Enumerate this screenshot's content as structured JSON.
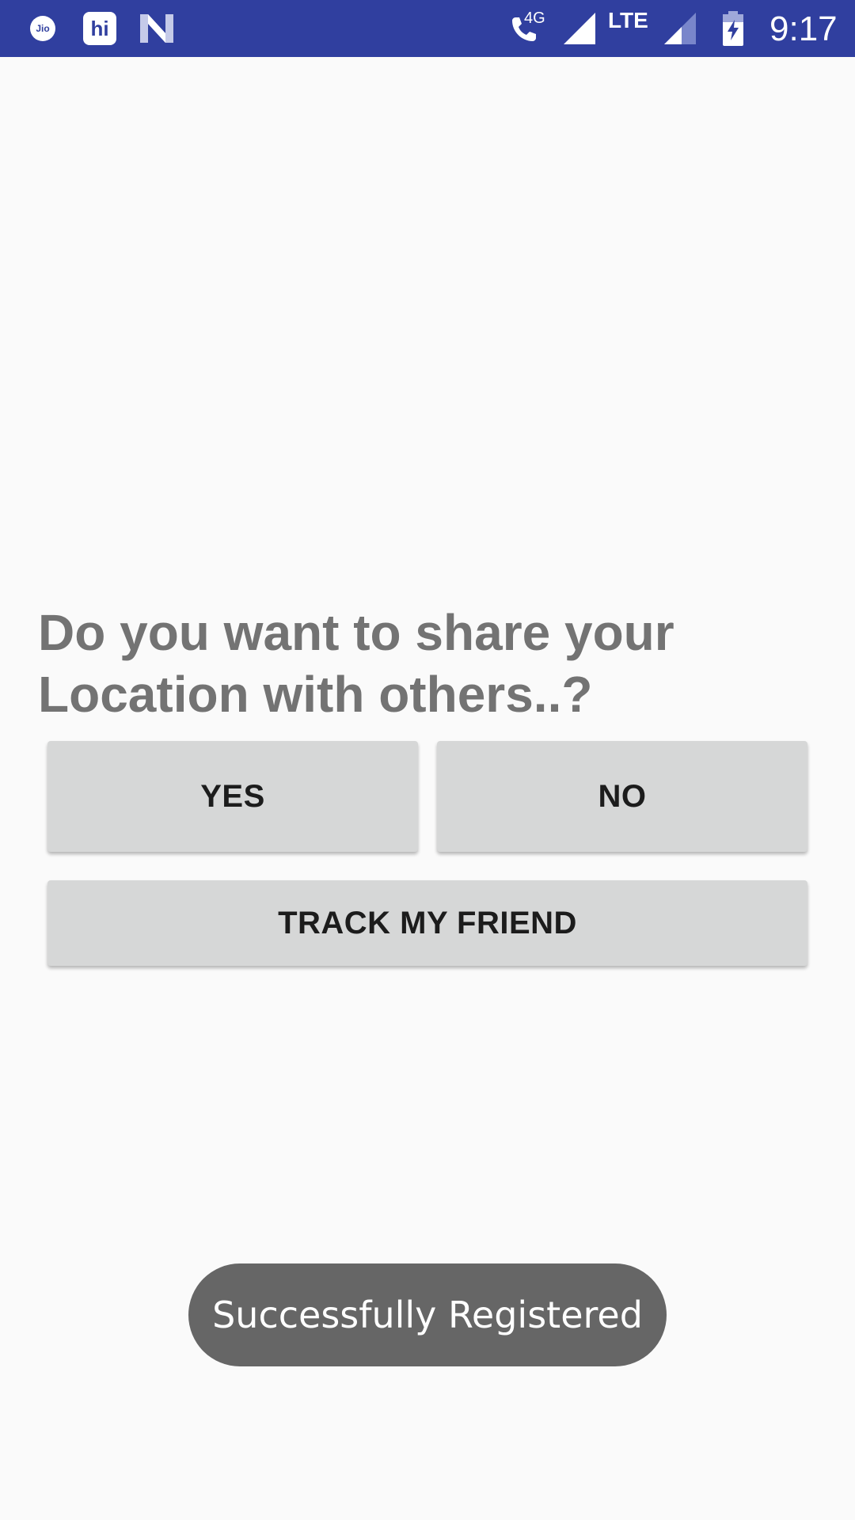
{
  "status_bar": {
    "time": "9:17",
    "network_type": "4G",
    "lte_label": "LTE",
    "carrier_icon_text": "Jio",
    "hi_icon_text": "hi",
    "icons": [
      "jio-icon",
      "hi-icon",
      "n-icon",
      "call-icon",
      "signal-icon",
      "signal-icon",
      "battery-charging-icon"
    ],
    "background_color": "#303f9f"
  },
  "main": {
    "question": "Do you want to share your Location with others..?",
    "yes_button": "YES",
    "no_button": "NO",
    "track_button": "TRACK MY FRIEND"
  },
  "toast": {
    "message": "Successfully Registered"
  }
}
